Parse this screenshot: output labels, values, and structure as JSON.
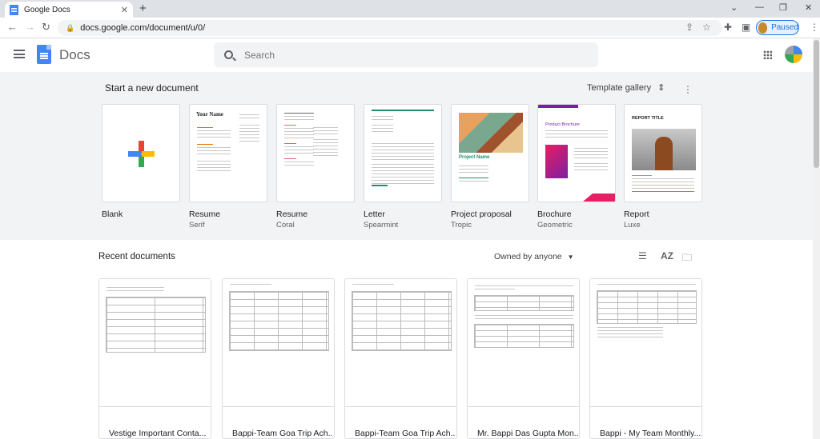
{
  "browser": {
    "tab_title": "Google Docs",
    "tab_close": "✕",
    "new_tab": "+",
    "url": "docs.google.com/document/u/0/",
    "profile_status": "Paused",
    "window_minimize": "⌄",
    "window_min": "—",
    "window_restore": "❐",
    "window_close": "✕"
  },
  "app": {
    "title": "Docs",
    "search_placeholder": "Search"
  },
  "templates": {
    "heading": "Start a new document",
    "gallery_label": "Template gallery",
    "items": [
      {
        "name": "Blank",
        "subtitle": ""
      },
      {
        "name": "Resume",
        "subtitle": "Serif",
        "thumb_title": "Your Name"
      },
      {
        "name": "Resume",
        "subtitle": "Coral"
      },
      {
        "name": "Letter",
        "subtitle": "Spearmint"
      },
      {
        "name": "Project proposal",
        "subtitle": "Tropic",
        "thumb_title": "Project Name"
      },
      {
        "name": "Brochure",
        "subtitle": "Geometric",
        "thumb_title": "Product Brochure"
      },
      {
        "name": "Report",
        "subtitle": "Luxe",
        "thumb_title": "REPORT TITLE"
      }
    ]
  },
  "recent": {
    "heading": "Recent documents",
    "owner_filter": "Owned by anyone",
    "documents": [
      {
        "name": "Vestige Important Conta..."
      },
      {
        "name": "Bappi-Team Goa Trip Ach..."
      },
      {
        "name": "Bappi-Team Goa Trip Ach..."
      },
      {
        "name": "Mr. Bappi Das Gupta Mon..."
      },
      {
        "name": "Bappi - My Team Monthly..."
      }
    ]
  },
  "colors": {
    "accent": "#1a73e8",
    "docs_blue": "#4285f4",
    "template_bg": "#f1f3f4"
  }
}
